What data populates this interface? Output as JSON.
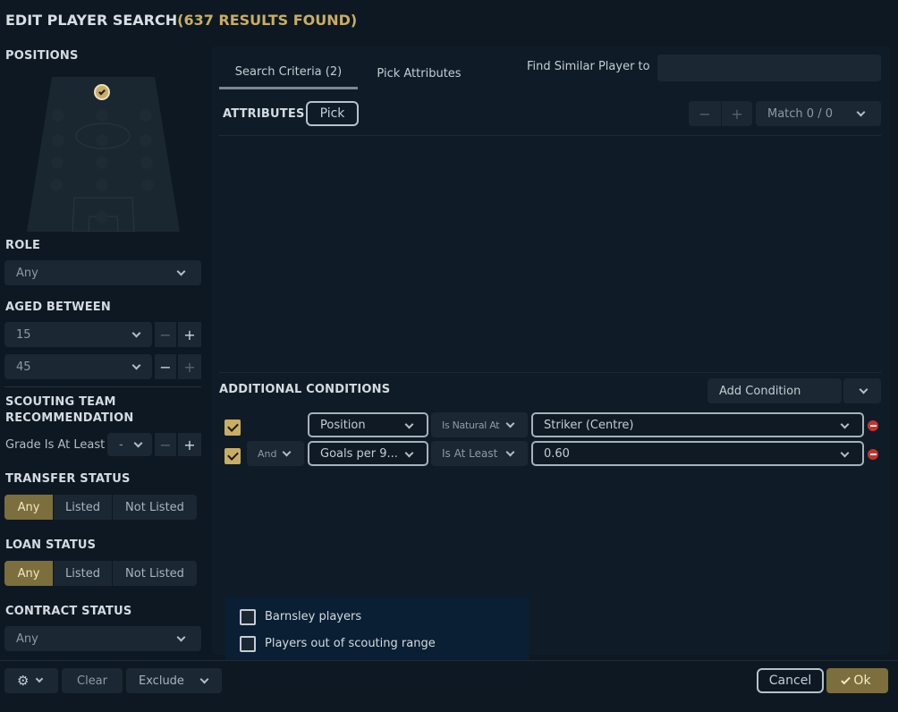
{
  "title": "EDIT PLAYER SEARCH",
  "results": "(637 RESULTS FOUND)",
  "sidebar": {
    "positions_label": "POSITIONS",
    "role_label": "ROLE",
    "role_value": "Any",
    "aged_label": "AGED BETWEEN",
    "age_min": "15",
    "age_max": "45",
    "scouting_label_1": "SCOUTING TEAM",
    "scouting_label_2": "RECOMMENDATION",
    "grade_label": "Grade Is At Least",
    "grade_value": "-",
    "transfer_label": "TRANSFER STATUS",
    "transfer_options": [
      "Any",
      "Listed",
      "Not Listed"
    ],
    "loan_label": "LOAN STATUS",
    "loan_options": [
      "Any",
      "Listed",
      "Not Listed"
    ],
    "contract_label": "CONTRACT STATUS",
    "contract_value": "Any"
  },
  "tabs": [
    "Search Criteria (2)",
    "Pick Attributes"
  ],
  "similar": {
    "label": "Find Similar Player to",
    "placeholder": ""
  },
  "attributes": {
    "label": "ATTRIBUTES",
    "pick_label": "Pick",
    "minus": "−",
    "plus": "+",
    "match_label": "Match 0 / 0"
  },
  "conditions": {
    "label": "ADDITIONAL CONDITIONS",
    "add_label": "Add Condition",
    "rows": [
      {
        "join": "",
        "field": "Position",
        "op": "Is Natural At",
        "value": "Striker (Centre)"
      },
      {
        "join": "And",
        "field": "Goals per 9...",
        "op": "Is At Least",
        "value": "0.60"
      }
    ]
  },
  "filters": {
    "barnsley": "Barnsley players",
    "out_of_range": "Players out of scouting range"
  },
  "footer": {
    "clear": "Clear",
    "exclude": "Exclude",
    "cancel": "Cancel",
    "ok": "Ok"
  },
  "steppers": {
    "minus": "−",
    "plus": "+"
  },
  "colors": {
    "accent": "#c9ae62",
    "selected": "#7c6f3d",
    "remove": "#c8312a"
  }
}
